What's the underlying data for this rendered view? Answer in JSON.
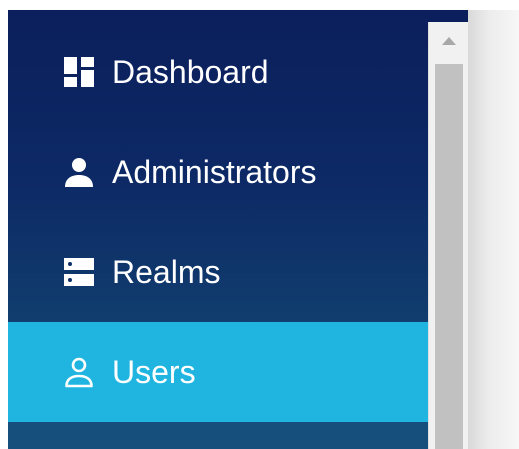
{
  "sidebar": {
    "items": [
      {
        "label": "Dashboard",
        "icon": "dashboard-icon",
        "active": false
      },
      {
        "label": "Administrators",
        "icon": "person-icon",
        "active": false
      },
      {
        "label": "Realms",
        "icon": "server-icon",
        "active": false
      },
      {
        "label": "Users",
        "icon": "person-outline-icon",
        "active": true
      }
    ]
  },
  "colors": {
    "sidebar_top": "#0b1f5c",
    "sidebar_bottom": "#134a78",
    "active_item": "#1fb5e0",
    "text": "#ffffff",
    "scrollbar_track": "#f1f1f1",
    "scrollbar_thumb": "#c1c1c1"
  }
}
